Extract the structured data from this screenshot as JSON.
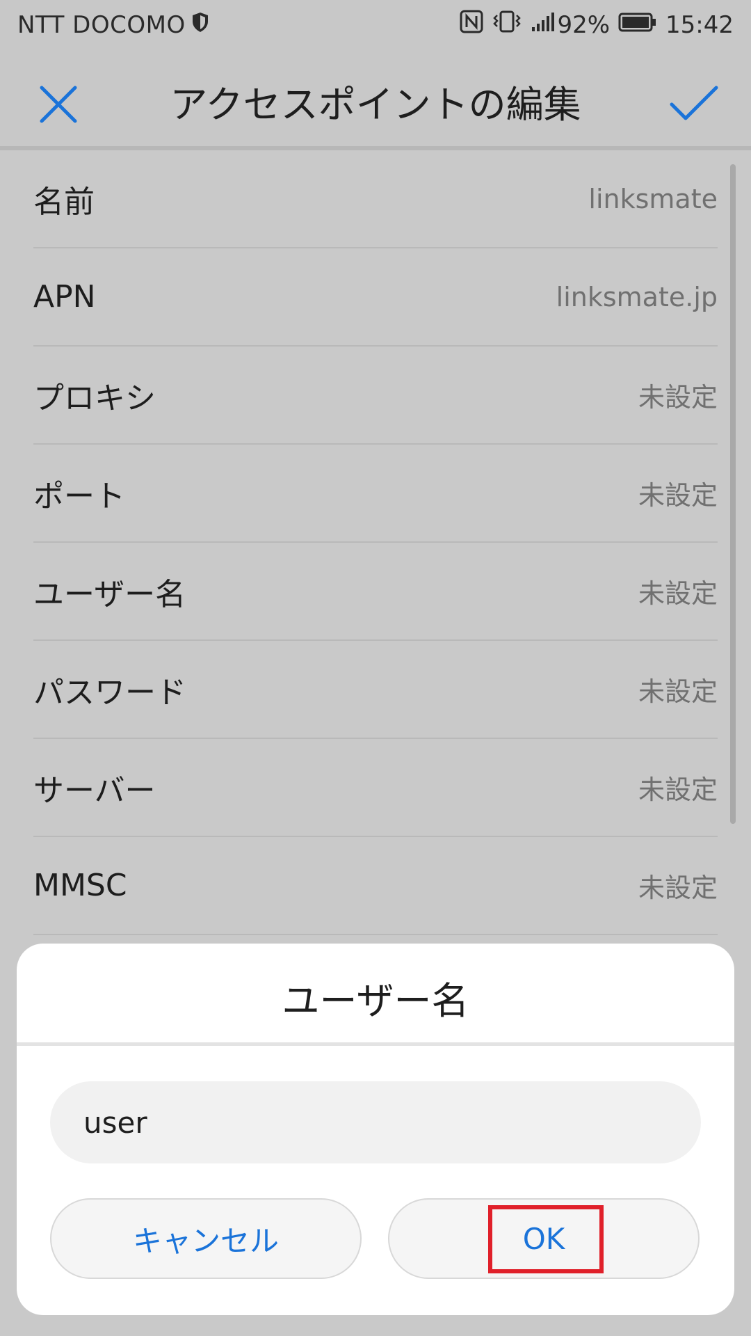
{
  "status_bar": {
    "carrier": "NTT DOCOMO",
    "battery": "92%",
    "time": "15:42"
  },
  "header": {
    "title": "アクセスポイントの編集",
    "close_icon": "close-icon",
    "confirm_icon": "check-icon",
    "accent": "#1a73d9"
  },
  "list": {
    "items": [
      {
        "label": "名前",
        "value": "linksmate"
      },
      {
        "label": "APN",
        "value": "linksmate.jp"
      },
      {
        "label": "プロキシ",
        "value": "未設定"
      },
      {
        "label": "ポート",
        "value": "未設定"
      },
      {
        "label": "ユーザー名",
        "value": "未設定"
      },
      {
        "label": "パスワード",
        "value": "未設定"
      },
      {
        "label": "サーバー",
        "value": "未設定"
      },
      {
        "label": "MMSC",
        "value": "未設定"
      }
    ]
  },
  "dialog": {
    "title": "ユーザー名",
    "input_value": "user",
    "cancel_label": "キャンセル",
    "ok_label": "OK"
  }
}
